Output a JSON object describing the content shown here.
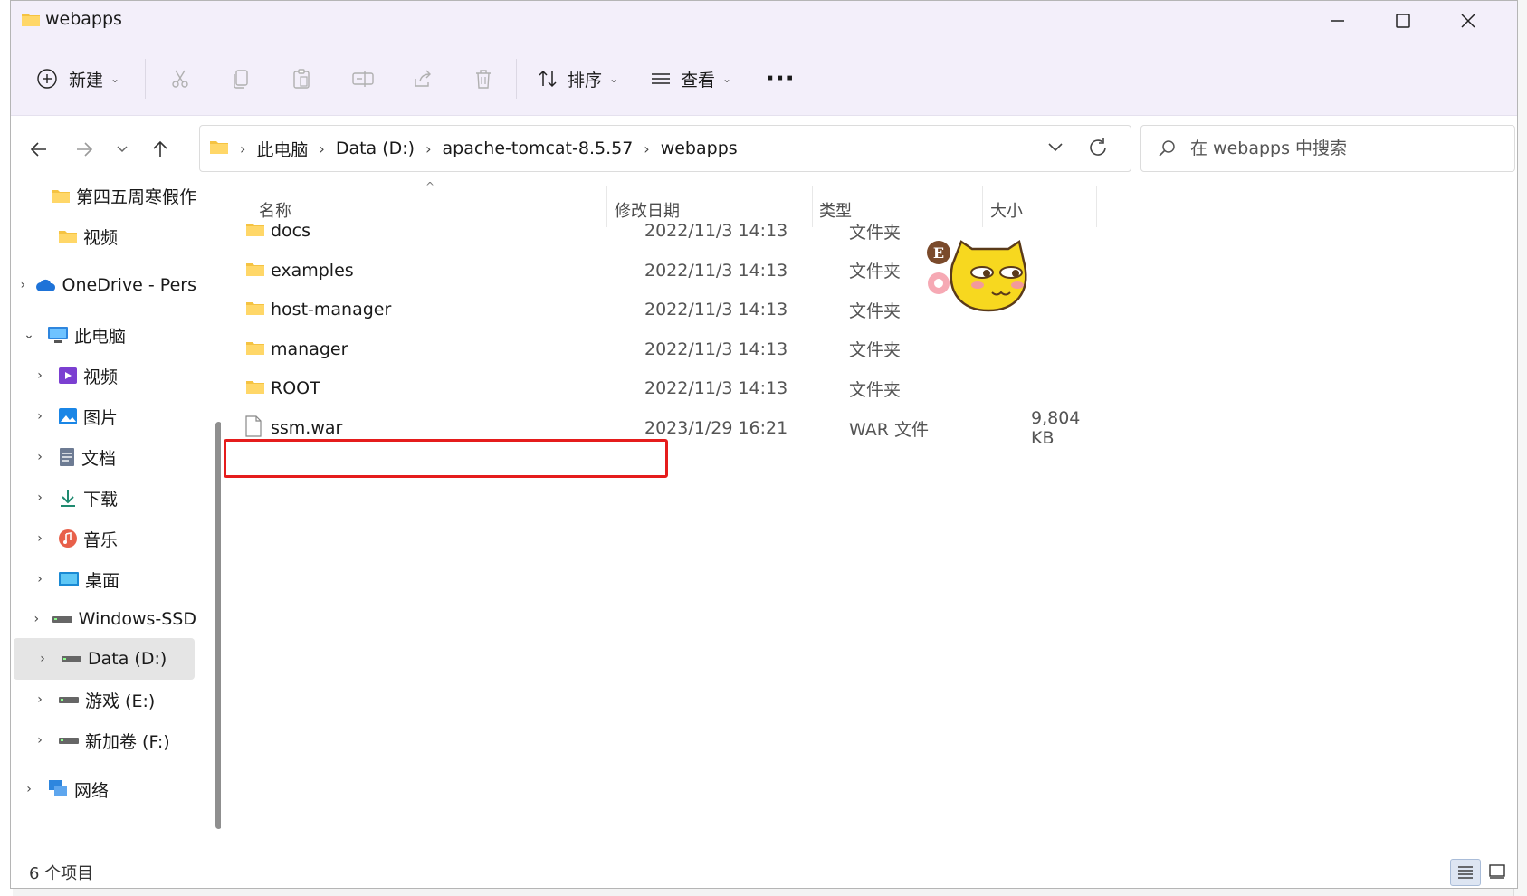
{
  "window": {
    "title": "webapps",
    "minimize_glyph": "—",
    "maximize_glyph": "☐",
    "close_glyph": "✕"
  },
  "toolbar": {
    "new_label": "新建",
    "sort_label": "排序",
    "view_label": "查看",
    "more_glyph": "···",
    "icons": [
      "plus-circle-icon",
      "cut-icon",
      "copy-icon",
      "paste-icon",
      "rename-icon",
      "share-icon",
      "delete-icon",
      "sort-icon",
      "view-icon"
    ]
  },
  "address": {
    "crumbs": [
      "此电脑",
      "Data (D:)",
      "apache-tomcat-8.5.57",
      "webapps"
    ],
    "search_placeholder": "在 webapps 中搜索"
  },
  "sidebar": {
    "items": [
      {
        "label": "第四五周寒假作",
        "icon": "folder-icon",
        "indent": 2,
        "chev": ""
      },
      {
        "label": "视频",
        "icon": "folder-icon",
        "indent": 2,
        "chev": ""
      },
      {
        "label": "OneDrive - Pers",
        "icon": "cloud-icon",
        "indent": 1,
        "chev": "›"
      },
      {
        "label": "此电脑",
        "icon": "computer-icon",
        "indent": 1,
        "chev": "⌄"
      },
      {
        "label": "视频",
        "icon": "video-icon",
        "indent": 2,
        "chev": "›"
      },
      {
        "label": "图片",
        "icon": "pictures-icon",
        "indent": 2,
        "chev": "›"
      },
      {
        "label": "文档",
        "icon": "documents-icon",
        "indent": 2,
        "chev": "›"
      },
      {
        "label": "下载",
        "icon": "download-icon",
        "indent": 2,
        "chev": "›"
      },
      {
        "label": "音乐",
        "icon": "music-icon",
        "indent": 2,
        "chev": "›"
      },
      {
        "label": "桌面",
        "icon": "desktop-icon",
        "indent": 2,
        "chev": "›"
      },
      {
        "label": "Windows-SSD",
        "icon": "drive-icon",
        "indent": 2,
        "chev": "›"
      },
      {
        "label": "Data (D:)",
        "icon": "drive-icon",
        "indent": 2,
        "chev": "›",
        "selected": true
      },
      {
        "label": "游戏 (E:)",
        "icon": "drive-icon",
        "indent": 2,
        "chev": "›"
      },
      {
        "label": "新加卷 (F:)",
        "icon": "drive-icon",
        "indent": 2,
        "chev": "›"
      },
      {
        "label": "网络",
        "icon": "network-icon",
        "indent": 1,
        "chev": "›"
      }
    ]
  },
  "columns": {
    "name": "名称",
    "date": "修改日期",
    "type": "类型",
    "size": "大小"
  },
  "files": [
    {
      "name": "docs",
      "date": "2022/11/3 14:13",
      "type": "文件夹",
      "size": "",
      "kind": "folder"
    },
    {
      "name": "examples",
      "date": "2022/11/3 14:13",
      "type": "文件夹",
      "size": "",
      "kind": "folder"
    },
    {
      "name": "host-manager",
      "date": "2022/11/3 14:13",
      "type": "文件夹",
      "size": "",
      "kind": "folder"
    },
    {
      "name": "manager",
      "date": "2022/11/3 14:13",
      "type": "文件夹",
      "size": "",
      "kind": "folder"
    },
    {
      "name": "ROOT",
      "date": "2022/11/3 14:13",
      "type": "文件夹",
      "size": "",
      "kind": "folder"
    },
    {
      "name": "ssm.war",
      "date": "2023/1/29 16:21",
      "type": "WAR 文件",
      "size": "9,804 KB",
      "kind": "file"
    }
  ],
  "status": {
    "count": "6 个项目"
  },
  "sticker": {
    "badge_letter": "E",
    "accent": "#f7d81f"
  },
  "colors": {
    "highlight": "#e51c1c",
    "folder": "#f5c342",
    "titlebar": "#f3effa"
  }
}
